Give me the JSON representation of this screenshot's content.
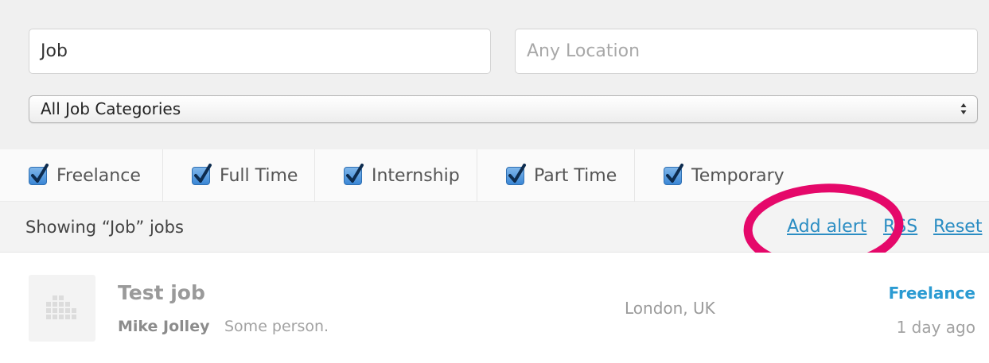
{
  "search": {
    "keywords_value": "Job",
    "location_placeholder": "Any Location",
    "category_selected": "All Job Categories"
  },
  "job_types": [
    {
      "label": "Freelance",
      "checked": true
    },
    {
      "label": "Full Time",
      "checked": true
    },
    {
      "label": "Internship",
      "checked": true
    },
    {
      "label": "Part Time",
      "checked": true
    },
    {
      "label": "Temporary",
      "checked": true
    }
  ],
  "results": {
    "showing_text": "Showing “Job” jobs",
    "add_alert": "Add alert",
    "rss": "RSS",
    "reset": "Reset"
  },
  "listing": {
    "title": "Test job",
    "company": "Mike Jolley",
    "tagline": "Some person.",
    "location": "London, UK",
    "type": "Freelance",
    "date": "1 day ago"
  },
  "colors": {
    "link": "#2b8dc3",
    "job_type": "#2b9bd2",
    "highlight": "#e5086a",
    "checkbox": "#3b87d6"
  },
  "icons": {
    "checkbox": "checkmark-icon",
    "select": "updown-arrows-icon",
    "logo": "company-logo-placeholder-icon"
  }
}
